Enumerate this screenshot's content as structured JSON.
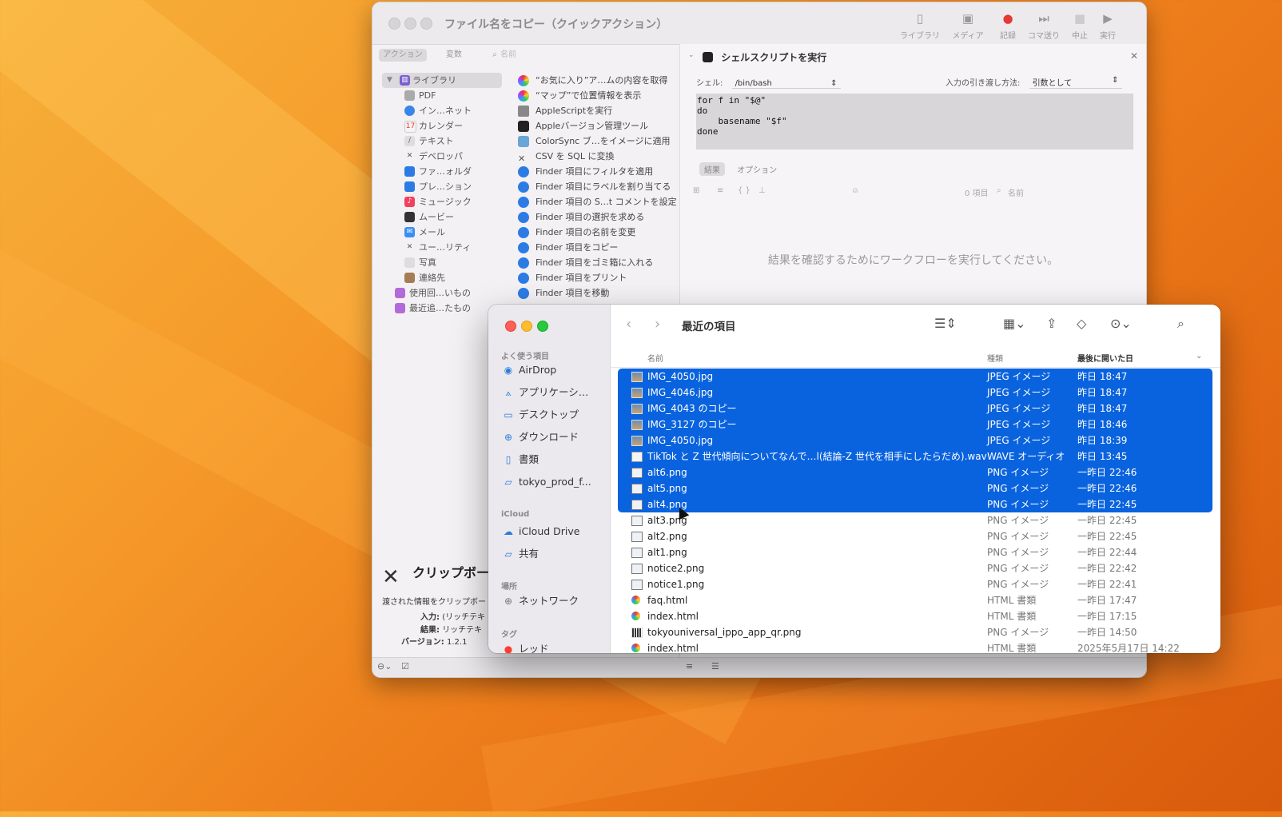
{
  "automator": {
    "title": "ファイル名をコピー（クイックアクション）",
    "toolbar": [
      {
        "label": "ライブラリ",
        "icon": "sidebar-icon"
      },
      {
        "label": "メディア",
        "icon": "media-icon"
      },
      {
        "label": "記録",
        "icon": "record-icon"
      },
      {
        "label": "コマ送り",
        "icon": "step-icon"
      },
      {
        "label": "中止",
        "icon": "stop-icon"
      },
      {
        "label": "実行",
        "icon": "run-icon"
      }
    ],
    "tabs": {
      "actions": "アクション",
      "variables": "変数",
      "search_placeholder": "名前"
    },
    "library": [
      "ライブラリ",
      "PDF",
      "イン…ネット",
      "カレンダー",
      "テキスト",
      "デベロッパ",
      "ファ…ォルダ",
      "プレ…ション",
      "ミュージック",
      "ムービー",
      "メール",
      "ユー…リティ",
      "写真",
      "連絡先",
      "使用回…いもの",
      "最近追…たもの"
    ],
    "actions": [
      "“お気に入り”ア…ムの内容を取得",
      "“マップ”で位置情報を表示",
      "AppleScriptを実行",
      "Appleバージョン管理ツール",
      "ColorSync ブ…をイメージに適用",
      "CSV を SQL に変換",
      "Finder 項目にフィルタを適用",
      "Finder 項目にラベルを割り当てる",
      "Finder 項目の S…t コメントを設定",
      "Finder 項目の選択を求める",
      "Finder 項目の名前を変更",
      "Finder 項目をコピー",
      "Finder 項目をゴミ箱に入れる",
      "Finder 項目をプリント",
      "Finder 項目を移動"
    ],
    "shell": {
      "title": "シェルスクリプトを実行",
      "shell_label": "シェル:",
      "shell_value": "/bin/bash",
      "pass_label": "入力の引き渡し方法:",
      "pass_value": "引数として",
      "code": [
        "for f in \"$@\"",
        "do",
        "    basename \"$f\"",
        "done"
      ],
      "result_tab": "結果",
      "options_tab": "オプション",
      "count": "0 項目",
      "name_col": "名前",
      "empty_msg": "結果を確認するためにワークフローを実行してください。"
    },
    "clip": {
      "title": "クリップボー",
      "desc": "渡された情報をクリップボー",
      "input_label": "入力:",
      "input_value": "(リッチテキ",
      "result_label": "結果:",
      "result_value": "リッチテキ",
      "version_label": "バージョン:",
      "version_value": "1.2.1"
    }
  },
  "finder": {
    "title": "最近の項目",
    "sidebar": {
      "favorites_label": "よく使う項目",
      "favorites": [
        {
          "label": "AirDrop",
          "icon": "airdrop-icon"
        },
        {
          "label": "アプリケーシ…",
          "icon": "applications-icon"
        },
        {
          "label": "デスクトップ",
          "icon": "desktop-icon"
        },
        {
          "label": "ダウンロード",
          "icon": "download-icon"
        },
        {
          "label": "書類",
          "icon": "document-icon"
        },
        {
          "label": "tokyo_prod_f...",
          "icon": "folder-icon"
        }
      ],
      "icloud_label": "iCloud",
      "icloud": [
        {
          "label": "iCloud Drive",
          "icon": "cloud-icon"
        },
        {
          "label": "共有",
          "icon": "shared-folder-icon"
        }
      ],
      "locations_label": "場所",
      "locations": [
        {
          "label": "ネットワーク",
          "icon": "network-icon"
        }
      ],
      "tags_label": "タグ",
      "tags": [
        {
          "label": "レッド",
          "color": "#fe3b30"
        }
      ]
    },
    "columns": {
      "name": "名前",
      "kind": "種類",
      "date": "最後に開いた日"
    },
    "files": [
      {
        "name": "IMG_4050.jpg",
        "kind": "JPEG イメージ",
        "date": "昨日 18:47",
        "selected": true,
        "icon": "img"
      },
      {
        "name": "IMG_4046.jpg",
        "kind": "JPEG イメージ",
        "date": "昨日 18:47",
        "selected": true,
        "icon": "img"
      },
      {
        "name": "IMG_4043 のコピー",
        "kind": "JPEG イメージ",
        "date": "昨日 18:47",
        "selected": true,
        "icon": "img"
      },
      {
        "name": "IMG_3127 のコピー",
        "kind": "JPEG イメージ",
        "date": "昨日 18:46",
        "selected": true,
        "icon": "img"
      },
      {
        "name": "IMG_4050.jpg",
        "kind": "JPEG イメージ",
        "date": "昨日 18:39",
        "selected": true,
        "icon": "img"
      },
      {
        "name": "TikTok と Z 世代傾向についてなんで…l(結論-Z 世代を相手にしたらだめ).wav",
        "kind": "WAVE オーディオ",
        "date": "昨日 13:45",
        "selected": true,
        "icon": "wav"
      },
      {
        "name": "alt6.png",
        "kind": "PNG イメージ",
        "date": "一昨日 22:46",
        "selected": true,
        "icon": "png"
      },
      {
        "name": "alt5.png",
        "kind": "PNG イメージ",
        "date": "一昨日 22:46",
        "selected": true,
        "icon": "png"
      },
      {
        "name": "alt4.png",
        "kind": "PNG イメージ",
        "date": "一昨日 22:45",
        "selected": true,
        "icon": "png"
      },
      {
        "name": "alt3.png",
        "kind": "PNG イメージ",
        "date": "一昨日 22:45",
        "selected": false,
        "icon": "png"
      },
      {
        "name": "alt2.png",
        "kind": "PNG イメージ",
        "date": "一昨日 22:45",
        "selected": false,
        "icon": "png"
      },
      {
        "name": "alt1.png",
        "kind": "PNG イメージ",
        "date": "一昨日 22:44",
        "selected": false,
        "icon": "png"
      },
      {
        "name": "notice2.png",
        "kind": "PNG イメージ",
        "date": "一昨日 22:42",
        "selected": false,
        "icon": "png"
      },
      {
        "name": "notice1.png",
        "kind": "PNG イメージ",
        "date": "一昨日 22:41",
        "selected": false,
        "icon": "png"
      },
      {
        "name": "faq.html",
        "kind": "HTML 書類",
        "date": "一昨日 17:47",
        "selected": false,
        "icon": "html"
      },
      {
        "name": "index.html",
        "kind": "HTML 書類",
        "date": "一昨日 17:15",
        "selected": false,
        "icon": "html"
      },
      {
        "name": "tokyouniversal_ippo_app_qr.png",
        "kind": "PNG イメージ",
        "date": "一昨日 14:50",
        "selected": false,
        "icon": "qr"
      },
      {
        "name": "index.html",
        "kind": "HTML 書類",
        "date": "2025年5月17日 14:22",
        "selected": false,
        "icon": "html"
      }
    ]
  }
}
